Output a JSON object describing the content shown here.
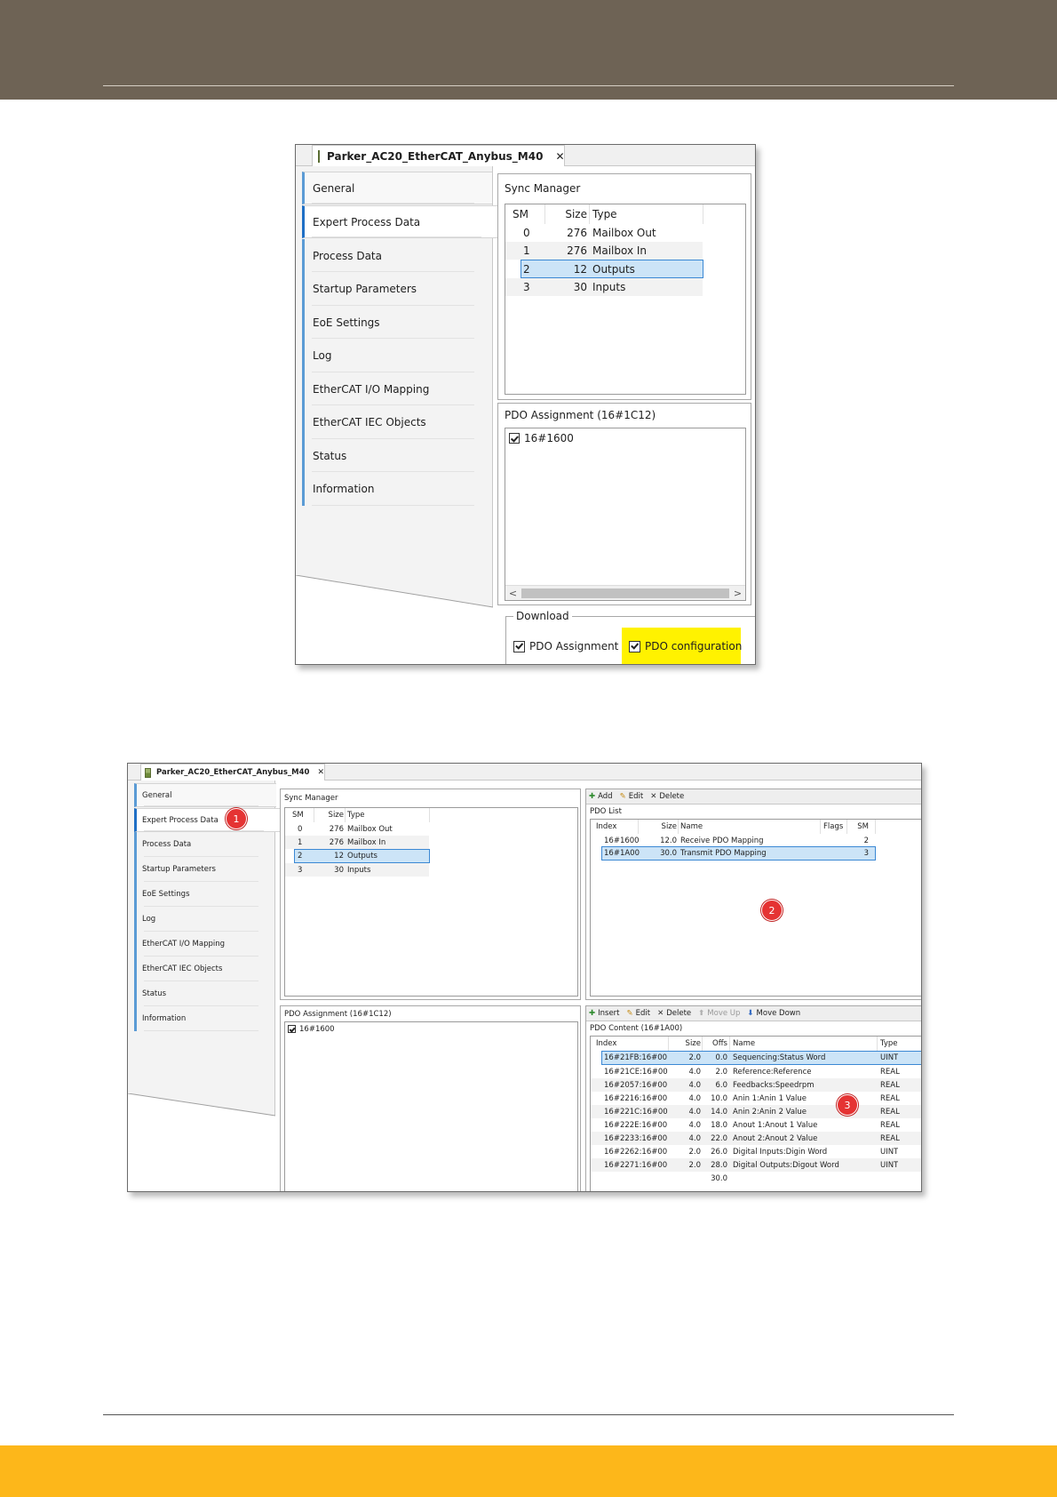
{
  "screenshot1": {
    "tab_title": "Parker_AC20_EtherCAT_Anybus_M40",
    "close_glyph": "✕",
    "nav_items": [
      "General",
      "Expert Process Data",
      "Process Data",
      "Startup Parameters",
      "EoE Settings",
      "Log",
      "EtherCAT I/O Mapping",
      "EtherCAT IEC Objects",
      "Status",
      "Information"
    ],
    "sync_manager": {
      "title": "Sync Manager",
      "headers": [
        "SM",
        "Size",
        "Type"
      ],
      "rows": [
        {
          "sm": "0",
          "size": "276",
          "type": "Mailbox Out"
        },
        {
          "sm": "1",
          "size": "276",
          "type": "Mailbox In"
        },
        {
          "sm": "2",
          "size": "12",
          "type": "Outputs"
        },
        {
          "sm": "3",
          "size": "30",
          "type": "Inputs"
        }
      ]
    },
    "pdo_assignment": {
      "title": "PDO Assignment (16#1C12)",
      "items": [
        "16#1600"
      ]
    },
    "download": {
      "title": "Download",
      "pdo_assignment_label": "PDO Assignment",
      "pdo_configuration_label": "PDO configuration"
    },
    "scroll_left": "<",
    "scroll_right": ">"
  },
  "screenshot2": {
    "tab_title": "Parker_AC20_EtherCAT_Anybus_M40",
    "close_glyph": "✕",
    "nav_items": [
      "General",
      "Expert Process Data",
      "Process Data",
      "Startup Parameters",
      "EoE Settings",
      "Log",
      "EtherCAT I/O Mapping",
      "EtherCAT IEC Objects",
      "Status",
      "Information"
    ],
    "sync_manager": {
      "title": "Sync Manager",
      "headers": [
        "SM",
        "Size",
        "Type"
      ],
      "rows": [
        {
          "sm": "0",
          "size": "276",
          "type": "Mailbox Out"
        },
        {
          "sm": "1",
          "size": "276",
          "type": "Mailbox In"
        },
        {
          "sm": "2",
          "size": "12",
          "type": "Outputs"
        },
        {
          "sm": "3",
          "size": "30",
          "type": "Inputs"
        }
      ]
    },
    "pdo_list_toolbar": {
      "add": "Add",
      "edit": "Edit",
      "delete": "Delete"
    },
    "pdo_list": {
      "title": "PDO List",
      "headers": [
        "Index",
        "Size",
        "Name",
        "Flags",
        "SM"
      ],
      "rows": [
        {
          "index": "16#1600",
          "size": "12.0",
          "name": "Receive PDO Mapping",
          "flags": "",
          "sm": "2"
        },
        {
          "index": "16#1A00",
          "size": "30.0",
          "name": "Transmit PDO Mapping",
          "flags": "",
          "sm": "3"
        }
      ]
    },
    "pdo_assignment": {
      "title": "PDO Assignment (16#1C12)",
      "items": [
        "16#1600"
      ]
    },
    "pdo_content_toolbar": {
      "insert": "Insert",
      "edit": "Edit",
      "delete": "Delete",
      "move_up": "Move Up",
      "move_down": "Move Down"
    },
    "pdo_content": {
      "title": "PDO Content (16#1A00)",
      "headers": [
        "Index",
        "Size",
        "Offs",
        "Name",
        "Type"
      ],
      "rows": [
        {
          "index": "16#21FB:16#00",
          "size": "2.0",
          "offs": "0.0",
          "name": "Sequencing:Status Word",
          "type": "UINT"
        },
        {
          "index": "16#21CE:16#00",
          "size": "4.0",
          "offs": "2.0",
          "name": "Reference:Reference",
          "type": "REAL"
        },
        {
          "index": "16#2057:16#00",
          "size": "4.0",
          "offs": "6.0",
          "name": "Feedbacks:Speedrpm",
          "type": "REAL"
        },
        {
          "index": "16#2216:16#00",
          "size": "4.0",
          "offs": "10.0",
          "name": "Anin 1:Anin 1 Value",
          "type": "REAL"
        },
        {
          "index": "16#221C:16#00",
          "size": "4.0",
          "offs": "14.0",
          "name": "Anin 2:Anin 2 Value",
          "type": "REAL"
        },
        {
          "index": "16#222E:16#00",
          "size": "4.0",
          "offs": "18.0",
          "name": "Anout 1:Anout 1 Value",
          "type": "REAL"
        },
        {
          "index": "16#2233:16#00",
          "size": "4.0",
          "offs": "22.0",
          "name": "Anout 2:Anout 2 Value",
          "type": "REAL"
        },
        {
          "index": "16#2262:16#00",
          "size": "2.0",
          "offs": "26.0",
          "name": "Digital Inputs:Digin Word",
          "type": "UINT"
        },
        {
          "index": "16#2271:16#00",
          "size": "2.0",
          "offs": "28.0",
          "name": "Digital Outputs:Digout Word",
          "type": "UINT"
        },
        {
          "index": "",
          "size": "",
          "offs": "30.0",
          "name": "",
          "type": ""
        }
      ]
    },
    "markers": [
      "1",
      "2",
      "3"
    ]
  },
  "colors": {
    "header_band": "#6e6355",
    "footer_band": "#fdb71a",
    "selection": "#cce4f7",
    "highlight": "#fff200",
    "marker": "#e53333",
    "nav_accent": "#5b9bd5"
  }
}
